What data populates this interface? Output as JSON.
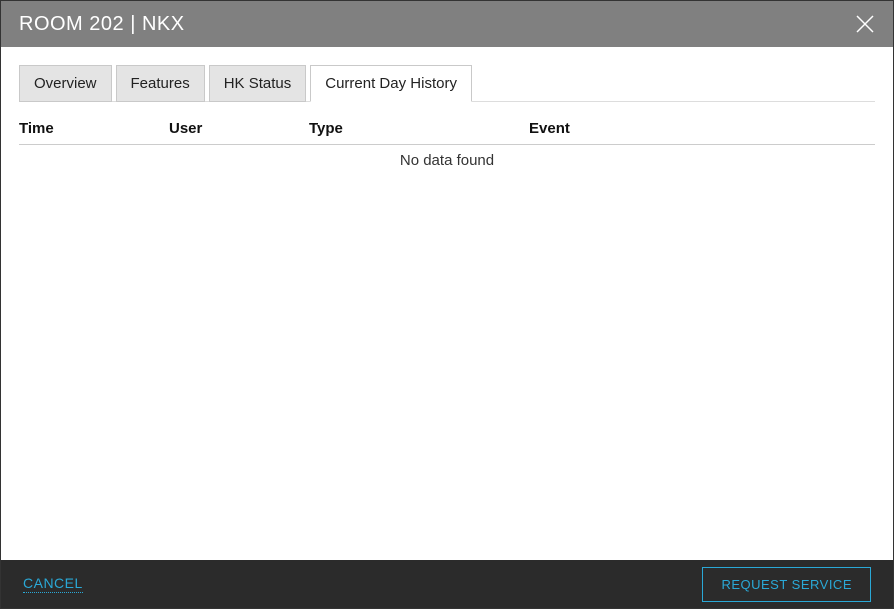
{
  "header": {
    "title": "ROOM 202 | NKX"
  },
  "tabs": [
    {
      "label": "Overview",
      "active": false
    },
    {
      "label": "Features",
      "active": false
    },
    {
      "label": "HK Status",
      "active": false
    },
    {
      "label": "Current Day History",
      "active": true
    }
  ],
  "table": {
    "columns": {
      "time": "Time",
      "user": "User",
      "type": "Type",
      "event": "Event"
    },
    "no_data": "No data found"
  },
  "footer": {
    "cancel": "CANCEL",
    "request_service": "REQUEST SERVICE"
  }
}
